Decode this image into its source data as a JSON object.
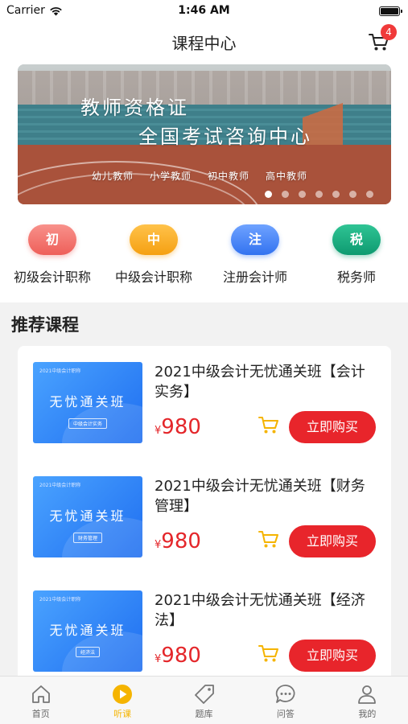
{
  "status_bar": {
    "carrier": "Carrier",
    "time": "1:46 AM"
  },
  "nav": {
    "title": "课程中心",
    "cart_count": "4"
  },
  "banner": {
    "title_line1": "教师资格证",
    "title_line2": "全国考试咨询中心",
    "tags": [
      "幼儿教师",
      "小学教师",
      "初中教师",
      "高中教师"
    ],
    "slide_count": 7,
    "active_slide": 1
  },
  "categories": [
    {
      "glyph": "初",
      "label": "初级会计职称",
      "color": "#f0706a"
    },
    {
      "glyph": "中",
      "label": "中级会计职称",
      "color": "#f5a623"
    },
    {
      "glyph": "注",
      "label": "注册会计师",
      "color": "#3d7ff5"
    },
    {
      "glyph": "税",
      "label": "税务师",
      "color": "#12a37a"
    }
  ],
  "recommend": {
    "title": "推荐课程",
    "courses": [
      {
        "name": "2021中级会计无忧通关班【会计实务】",
        "thumb_top": "2021中级会计职称",
        "thumb_main": "无忧通关班",
        "thumb_sub": "中级会计实务",
        "price_symbol": "¥",
        "price": "980",
        "buy_label": "立即购买"
      },
      {
        "name": "2021中级会计无忧通关班【财务管理】",
        "thumb_top": "2021中级会计职称",
        "thumb_main": "无忧通关班",
        "thumb_sub": "财务管理",
        "price_symbol": "¥",
        "price": "980",
        "buy_label": "立即购买"
      },
      {
        "name": "2021中级会计无忧通关班【经济法】",
        "thumb_top": "2021中级会计职称",
        "thumb_main": "无忧通关班",
        "thumb_sub": "经济法",
        "price_symbol": "¥",
        "price": "980",
        "buy_label": "立即购买"
      }
    ]
  },
  "tabbar": {
    "active_index": 1,
    "tabs": [
      {
        "label": "首页",
        "icon": "home-icon"
      },
      {
        "label": "听课",
        "icon": "play-icon"
      },
      {
        "label": "题库",
        "icon": "tag-icon"
      },
      {
        "label": "问答",
        "icon": "chat-icon"
      },
      {
        "label": "我的",
        "icon": "user-icon"
      }
    ]
  },
  "colors": {
    "accent": "#f5b400",
    "buy": "#e8252b",
    "price": "#e4262a",
    "badge": "#f03a3a"
  }
}
